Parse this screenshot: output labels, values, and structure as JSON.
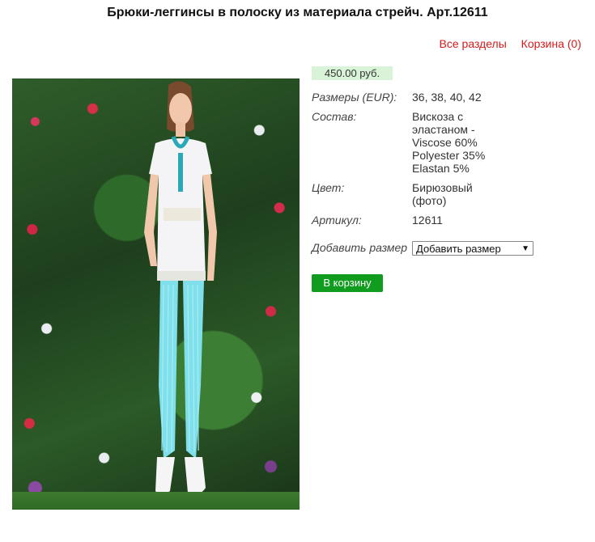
{
  "page_title": "Брюки-леггинсы в полоску из материала стрейч. Арт.12611",
  "nav": {
    "all_sections": "Все разделы",
    "cart": "Корзина (0)"
  },
  "product": {
    "price": "450.00 руб.",
    "sizes_label": "Размеры (EUR):",
    "sizes_value": "36, 38, 40, 42",
    "composition_label": "Состав:",
    "composition_value": "Вискоза с эластаном - Viscose 60% Polyester 35% Elastan 5%",
    "color_label": "Цвет:",
    "color_value": "Бирюзовый (фото)",
    "article_label": "Артикул:",
    "article_value": "12611",
    "add_size_label": "Добавить размер",
    "add_size_select": "Добавить размер",
    "add_to_cart": "В корзину"
  },
  "colors": {
    "link": "#d21c1c",
    "price_bg": "#d9f3d9",
    "button_bg": "#109c1f",
    "leggings": "#7fe0ec"
  },
  "icons": {
    "dropdown": "chevron-down-icon"
  }
}
